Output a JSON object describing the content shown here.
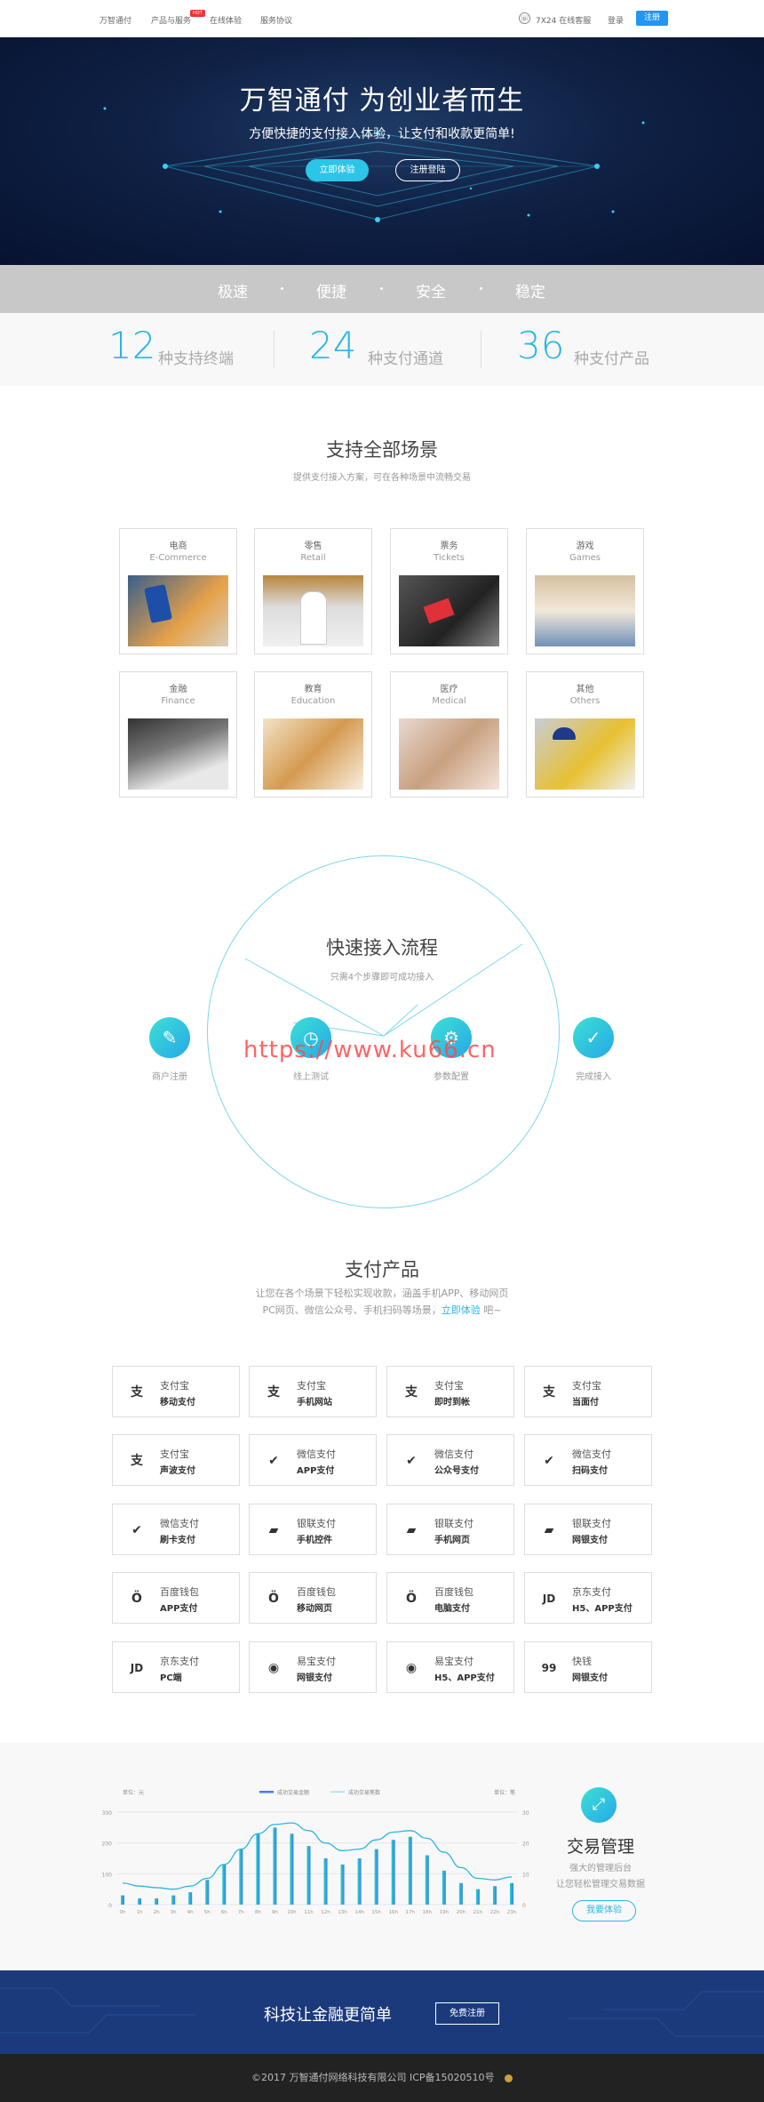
{
  "nav": {
    "items": [
      "万智通付",
      "产品与服务",
      "在线体验",
      "服务协议"
    ],
    "badge": "HOT",
    "service": "7X24 在线客服",
    "login": "登录",
    "register": "注册"
  },
  "hero": {
    "title": "万智通付 为创业者而生",
    "subtitle": "方便快捷的支付接入体验，让支付和收款更简单!",
    "btn_try": "立即体验",
    "btn_register": "注册登陆"
  },
  "features": [
    "极速",
    "便捷",
    "安全",
    "稳定"
  ],
  "stats": [
    {
      "num": "12",
      "text": "种支持终端"
    },
    {
      "num": "24",
      "text": "种支付通道"
    },
    {
      "num": "36",
      "text": "种支付产品"
    }
  ],
  "scenes": {
    "title": "支持全部场景",
    "subtitle": "提供支付接入方案，可在各种场景中流畅交易",
    "cards": [
      {
        "cn": "电商",
        "en": "E-Commerce"
      },
      {
        "cn": "零售",
        "en": "Retail"
      },
      {
        "cn": "票务",
        "en": "Tickets"
      },
      {
        "cn": "游戏",
        "en": "Games"
      },
      {
        "cn": "金融",
        "en": "Finance"
      },
      {
        "cn": "教育",
        "en": "Education"
      },
      {
        "cn": "医疗",
        "en": "Medical"
      },
      {
        "cn": "其他",
        "en": "Others"
      }
    ]
  },
  "flow": {
    "title": "快速接入流程",
    "subtitle": "只需4个步骤即可成功接入",
    "steps": [
      "商户注册",
      "线上测试",
      "参数配置",
      "完成接入"
    ],
    "watermark": "https://www.ku66.cn"
  },
  "products": {
    "title": "支付产品",
    "line1": "让您在各个场景下轻松实现收款，涵盖手机APP、移动网页",
    "line2a": "PC网页、微信公众号、手机扫码等场景，",
    "line2link": "立即体验",
    "line2b": " 吧~",
    "items": [
      {
        "icon": "alipay-icon",
        "glyph": "支",
        "name": "支付宝",
        "type": "移动支付"
      },
      {
        "icon": "alipay-icon",
        "glyph": "支",
        "name": "支付宝",
        "type": "手机网站"
      },
      {
        "icon": "alipay-icon",
        "glyph": "支",
        "name": "支付宝",
        "type": "即时到帐"
      },
      {
        "icon": "alipay-icon",
        "glyph": "支",
        "name": "支付宝",
        "type": "当面付"
      },
      {
        "icon": "alipay-icon",
        "glyph": "支",
        "name": "支付宝",
        "type": "声波支付"
      },
      {
        "icon": "wechat-icon",
        "glyph": "✔",
        "name": "微信支付",
        "type": "APP支付"
      },
      {
        "icon": "wechat-icon",
        "glyph": "✔",
        "name": "微信支付",
        "type": "公众号支付"
      },
      {
        "icon": "wechat-icon",
        "glyph": "✔",
        "name": "微信支付",
        "type": "扫码支付"
      },
      {
        "icon": "wechat-icon",
        "glyph": "✔",
        "name": "微信支付",
        "type": "刷卡支付"
      },
      {
        "icon": "unionpay-icon",
        "glyph": "▰",
        "name": "银联支付",
        "type": "手机控件"
      },
      {
        "icon": "unionpay-icon",
        "glyph": "▰",
        "name": "银联支付",
        "type": "手机网页"
      },
      {
        "icon": "unionpay-icon",
        "glyph": "▰",
        "name": "银联支付",
        "type": "网银支付"
      },
      {
        "icon": "baidu-wallet-icon",
        "glyph": "Ö",
        "name": "百度钱包",
        "type": "APP支付"
      },
      {
        "icon": "baidu-wallet-icon",
        "glyph": "Ö",
        "name": "百度钱包",
        "type": "移动网页"
      },
      {
        "icon": "baidu-wallet-icon",
        "glyph": "Ö",
        "name": "百度钱包",
        "type": "电脑支付"
      },
      {
        "icon": "jd-icon",
        "glyph": "JD",
        "name": "京东支付",
        "type": "H5、APP支付"
      },
      {
        "icon": "jd-icon",
        "glyph": "JD",
        "name": "京东支付",
        "type": "PC端"
      },
      {
        "icon": "yeepay-icon",
        "glyph": "◉",
        "name": "易宝支付",
        "type": "网银支付"
      },
      {
        "icon": "yeepay-icon",
        "glyph": "◉",
        "name": "易宝支付",
        "type": "H5、APP支付"
      },
      {
        "icon": "kuaiqian-icon",
        "glyph": "99",
        "name": "快钱",
        "type": "网银支付"
      }
    ]
  },
  "trade": {
    "title": "交易管理",
    "desc1": "强大的管理后台",
    "desc2": "让您轻松管理交易数据",
    "btn": "我要体验"
  },
  "chart_data": {
    "type": "bar",
    "left_unit": "单位：元",
    "right_unit": "单位：笔",
    "series": [
      {
        "name": "成功交易金额"
      },
      {
        "name": "成功交易笔数"
      }
    ],
    "categories": [
      "0h",
      "1h",
      "2h",
      "3h",
      "4h",
      "5h",
      "6h",
      "7h",
      "8h",
      "9h",
      "10h",
      "11h",
      "12h",
      "13h",
      "14h",
      "15h",
      "16h",
      "17h",
      "18h",
      "19h",
      "20h",
      "21h",
      "22h",
      "23h"
    ],
    "left_ticks": [
      "0",
      "100",
      "200",
      "300"
    ],
    "right_ticks": [
      "0",
      "10",
      "20",
      "30"
    ],
    "ylim": [
      0,
      300
    ],
    "values": [
      30,
      20,
      20,
      30,
      40,
      80,
      130,
      180,
      230,
      250,
      230,
      190,
      150,
      130,
      150,
      180,
      210,
      220,
      160,
      110,
      70,
      50,
      60,
      70
    ],
    "line_values": [
      70,
      60,
      55,
      50,
      60,
      85,
      130,
      180,
      230,
      260,
      265,
      240,
      200,
      175,
      180,
      210,
      235,
      240,
      215,
      170,
      120,
      85,
      80,
      90
    ],
    "colors": {
      "bar_start": "#24d2c6",
      "bar_end": "#3b7ff0",
      "line": "#2bb6e3"
    }
  },
  "cta": {
    "text": "科技让金融更简单",
    "btn": "免费注册"
  },
  "footer": {
    "text": "©2017 万智通付网络科技有限公司    ICP备15020510号"
  }
}
